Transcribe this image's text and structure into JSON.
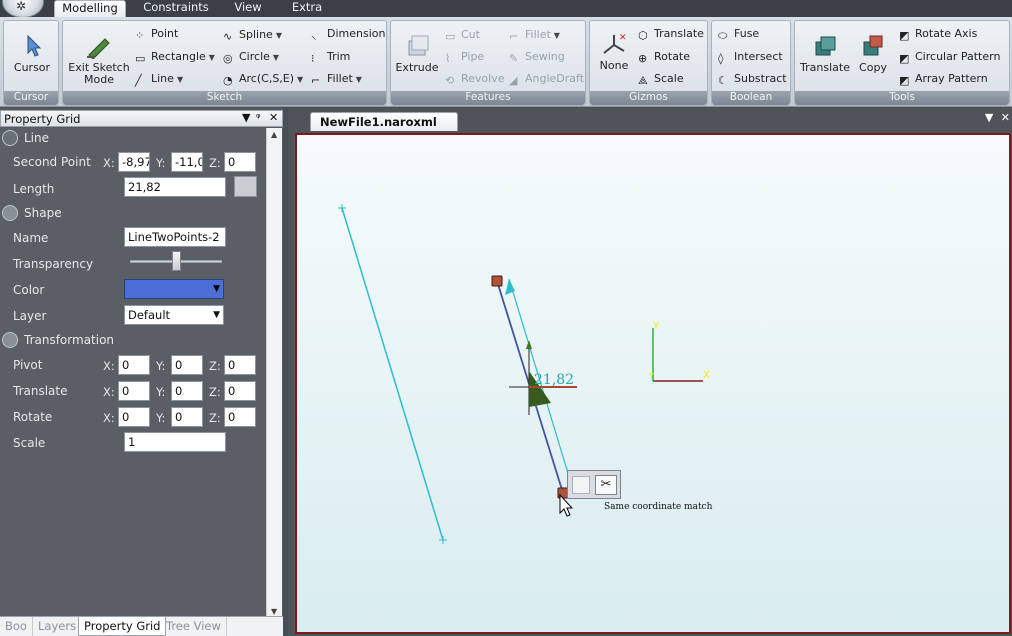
{
  "tabs": [
    "Modelling",
    "Constraints",
    "View",
    "Extra"
  ],
  "active_tab": "Modelling",
  "ribbon": {
    "cursor_group": {
      "label": "Cursor",
      "button": "Cursor"
    },
    "sketch_group": {
      "label": "Sketch",
      "exit_line1": "Exit Sketch",
      "exit_line2": "Mode",
      "point": "Point",
      "rectangle": "Rectangle",
      "line": "Line",
      "spline": "Spline",
      "circle": "Circle",
      "arc": "Arc(C,S,E)",
      "dimension": "Dimension",
      "trim": "Trim",
      "fillet": "Fillet"
    },
    "features_group": {
      "label": "Features",
      "extrude": "Extrude",
      "cut": "Cut",
      "pipe": "Pipe",
      "revolve": "Revolve",
      "fillet": "Fillet",
      "sewing": "Sewing",
      "angledraft": "AngleDraft"
    },
    "gizmos_group": {
      "label": "Gizmos",
      "none": "None",
      "translate": "Translate",
      "rotate": "Rotate",
      "scale": "Scale"
    },
    "boolean_group": {
      "label": "Boolean",
      "fuse": "Fuse",
      "intersect": "Intersect",
      "substract": "Substract"
    },
    "tools_group": {
      "label": "Tools",
      "translate": "Translate",
      "copy": "Copy",
      "rotate_axis": "Rotate Axis",
      "circular_pattern": "Circular Pattern",
      "array_pattern": "Array Pattern"
    }
  },
  "property_grid": {
    "title": "Property Grid",
    "line_section": "Line",
    "second_point_label": "Second Point",
    "second_point": {
      "x": "-8,97",
      "y": "-11,0",
      "z": "0"
    },
    "length_label": "Length",
    "length": "21,82",
    "shape_section": "Shape",
    "name_label": "Name",
    "name": "LineTwoPoints-2",
    "transparency_label": "Transparency",
    "transparency": 0.5,
    "color_label": "Color",
    "color": "#4a6ed6",
    "layer_label": "Layer",
    "layer": "Default",
    "transformation_section": "Transformation",
    "pivot_label": "Pivot",
    "pivot": {
      "x": "0",
      "y": "0",
      "z": "0"
    },
    "translate_label": "Translate",
    "translate": {
      "x": "0",
      "y": "0",
      "z": "0"
    },
    "rotate_label": "Rotate",
    "rotate": {
      "x": "0",
      "y": "0",
      "z": "0"
    },
    "scale_label": "Scale",
    "scale": "1"
  },
  "axis_labels": {
    "x": "X:",
    "y": "Y:",
    "z": "Z:"
  },
  "bottom_tabs": [
    "Boo",
    "Layers",
    "Property Grid",
    "Tree View"
  ],
  "active_bottom_tab": "Property Grid",
  "document": {
    "tab_title": "NewFile1.naroxml",
    "dimension_value": "21,82",
    "tooltip": "Same coordinate match"
  },
  "colors": {
    "sketch_line": "#2bbfc9",
    "selected_line": "#4455a0",
    "axis_x": "#8a1e1e",
    "axis_y": "#2fb52f",
    "axis_label": "#f2f000",
    "endpoint": "#b0533a"
  }
}
